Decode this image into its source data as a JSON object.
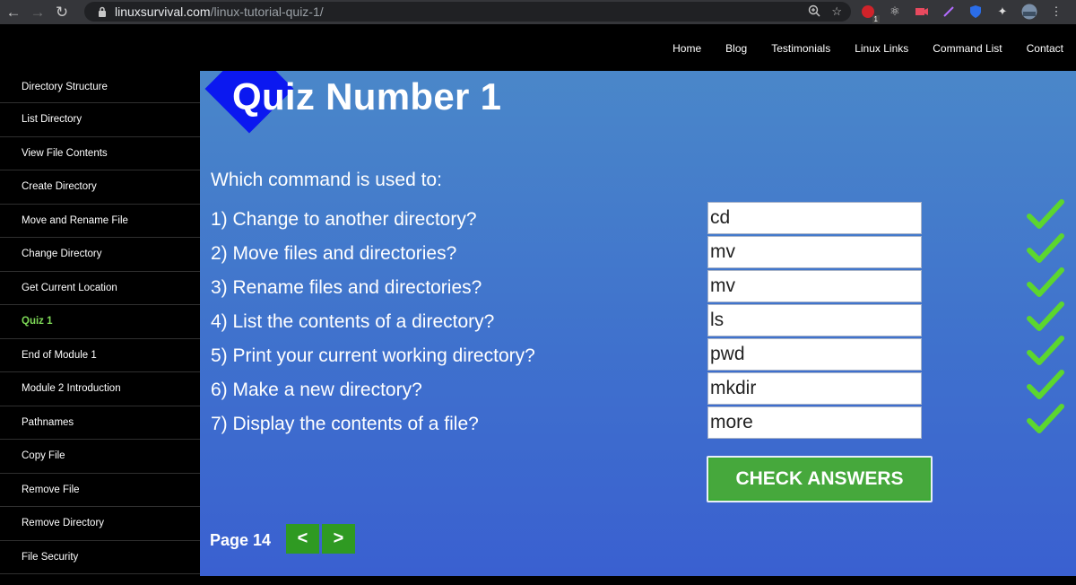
{
  "browser": {
    "url_domain": "linuxsurvival.com",
    "url_path": "/linux-tutorial-quiz-1/",
    "extension_badge": "1"
  },
  "topnav": [
    "Home",
    "Blog",
    "Testimonials",
    "Linux Links",
    "Command List",
    "Contact"
  ],
  "sidebar": {
    "items": [
      {
        "label": "Directory Structure"
      },
      {
        "label": "List Directory"
      },
      {
        "label": "View File Contents"
      },
      {
        "label": "Create Directory"
      },
      {
        "label": "Move and Rename File"
      },
      {
        "label": "Change Directory"
      },
      {
        "label": "Get Current Location"
      },
      {
        "label": "Quiz 1",
        "active": true
      },
      {
        "label": "End of Module 1"
      },
      {
        "label": "Module 2 Introduction"
      },
      {
        "label": "Pathnames"
      },
      {
        "label": "Copy File"
      },
      {
        "label": "Remove File"
      },
      {
        "label": "Remove Directory"
      },
      {
        "label": "File Security"
      }
    ]
  },
  "quiz": {
    "title": "Quiz Number 1",
    "heading": "Which command is used to:",
    "questions": [
      {
        "text": "1) Change to another directory?",
        "answer": "cd",
        "correct": true
      },
      {
        "text": "2) Move files and directories?",
        "answer": "mv",
        "correct": true
      },
      {
        "text": "3) Rename files and directories?",
        "answer": "mv",
        "correct": true
      },
      {
        "text": "4) List the contents of a directory?",
        "answer": "ls",
        "correct": true
      },
      {
        "text": "5) Print your current working directory?",
        "answer": "pwd",
        "correct": true
      },
      {
        "text": "6) Make a new directory?",
        "answer": "mkdir",
        "correct": true
      },
      {
        "text": "7) Display the contents of a file?",
        "answer": "more",
        "correct": true
      }
    ],
    "check_button": "CHECK ANSWERS"
  },
  "pager": {
    "label": "Page 14",
    "prev": "<",
    "next": ">"
  },
  "colors": {
    "active_sidebar": "#7ed957",
    "check_green": "#5cd62e",
    "button_green": "#3daa35",
    "diamond_blue": "#0b18f0"
  }
}
